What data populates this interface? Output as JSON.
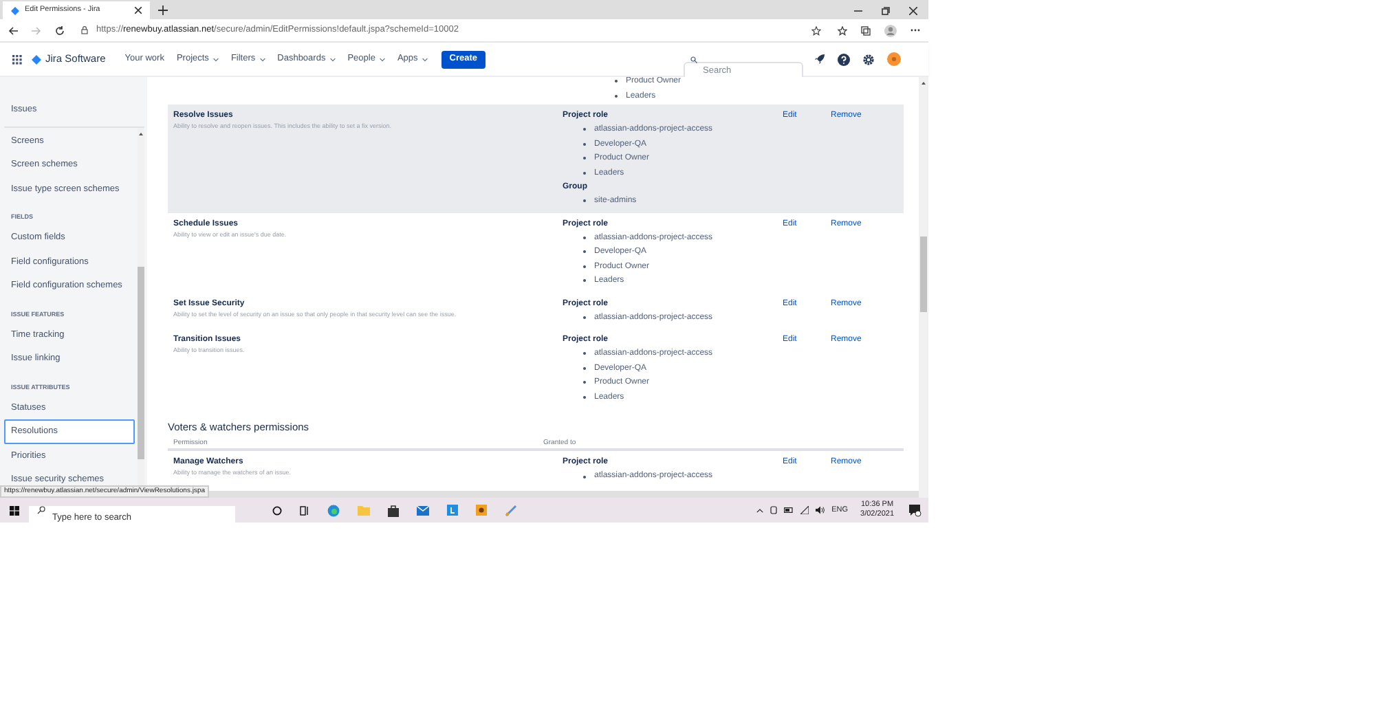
{
  "browser": {
    "tab_title": "Edit Permissions - Jira",
    "url": "https://**renewbuy.atlassian.net**/secure/admin/EditPermissions!default.jspa?schemeId=10002"
  },
  "nav": {
    "product": "Jira Software",
    "items": [
      {
        "label": "Your work",
        "dropdown": false
      },
      {
        "label": "Projects",
        "dropdown": true
      },
      {
        "label": "Filters",
        "dropdown": true
      },
      {
        "label": "Dashboards",
        "dropdown": true
      },
      {
        "label": "People",
        "dropdown": true
      },
      {
        "label": "Apps",
        "dropdown": true
      }
    ],
    "create": "Create",
    "search_placeholder": "Search"
  },
  "sidebar": {
    "heading": "Issues",
    "items": [
      {
        "kind": "link",
        "label": "Screens",
        "selected": false
      },
      {
        "kind": "link",
        "label": "Screen schemes",
        "selected": false
      },
      {
        "kind": "link",
        "label": "Issue type screen schemes",
        "selected": false
      },
      {
        "kind": "header",
        "label": "FIELDS"
      },
      {
        "kind": "link",
        "label": "Custom fields",
        "selected": false
      },
      {
        "kind": "link",
        "label": "Field configurations",
        "selected": false
      },
      {
        "kind": "link",
        "label": "Field configuration schemes",
        "selected": false
      },
      {
        "kind": "header",
        "label": "ISSUE FEATURES"
      },
      {
        "kind": "link",
        "label": "Time tracking",
        "selected": false
      },
      {
        "kind": "link",
        "label": "Issue linking",
        "selected": false
      },
      {
        "kind": "header",
        "label": "ISSUE ATTRIBUTES"
      },
      {
        "kind": "link",
        "label": "Statuses",
        "selected": false
      },
      {
        "kind": "link",
        "label": "Resolutions",
        "selected": true
      },
      {
        "kind": "link",
        "label": "Priorities",
        "selected": false
      },
      {
        "kind": "link",
        "label": "Issue security schemes",
        "selected": false
      }
    ]
  },
  "previous_grants": [
    "Product Owner",
    "Leaders"
  ],
  "permissions": [
    {
      "name": "Resolve Issues",
      "description": "Ability to resolve and reopen issues. This includes the ability to set a fix version.",
      "highlighted": true,
      "grants": [
        {
          "type": "Project role",
          "members": [
            "atlassian-addons-project-access",
            "Developer-QA",
            "Product Owner",
            "Leaders"
          ]
        },
        {
          "type": "Group",
          "members": [
            "site-admins"
          ]
        }
      ],
      "edit": "Edit",
      "remove": "Remove"
    },
    {
      "name": "Schedule Issues",
      "description": "Ability to view or edit an issue's due date.",
      "highlighted": false,
      "grants": [
        {
          "type": "Project role",
          "members": [
            "atlassian-addons-project-access",
            "Developer-QA",
            "Product Owner",
            "Leaders"
          ]
        }
      ],
      "edit": "Edit",
      "remove": "Remove"
    },
    {
      "name": "Set Issue Security",
      "description": "Ability to set the level of security on an issue so that only people in that security level can see the issue.",
      "highlighted": false,
      "grants": [
        {
          "type": "Project role",
          "members": [
            "atlassian-addons-project-access"
          ]
        }
      ],
      "edit": "Edit",
      "remove": "Remove"
    },
    {
      "name": "Transition Issues",
      "description": "Ability to transition issues.",
      "highlighted": false,
      "grants": [
        {
          "type": "Project role",
          "members": [
            "atlassian-addons-project-access",
            "Developer-QA",
            "Product Owner",
            "Leaders"
          ]
        }
      ],
      "edit": "Edit",
      "remove": "Remove"
    }
  ],
  "voters": {
    "title": "Voters & watchers permissions",
    "columns": [
      "Permission",
      "Granted to"
    ],
    "rows": [
      {
        "name": "Manage Watchers",
        "description": "Ability to manage the watchers of an issue.",
        "highlighted": false,
        "grants": [
          {
            "type": "Project role",
            "members": [
              "atlassian-addons-project-access"
            ]
          }
        ],
        "edit": "Edit",
        "remove": "Remove"
      }
    ]
  },
  "status_url": "https://renewbuy.atlassian.net/secure/admin/ViewResolutions.jspa",
  "taskbar": {
    "search_placeholder": "Type here to search",
    "language": "ENG",
    "time": "10:36 PM",
    "date": "3/02/2021"
  }
}
